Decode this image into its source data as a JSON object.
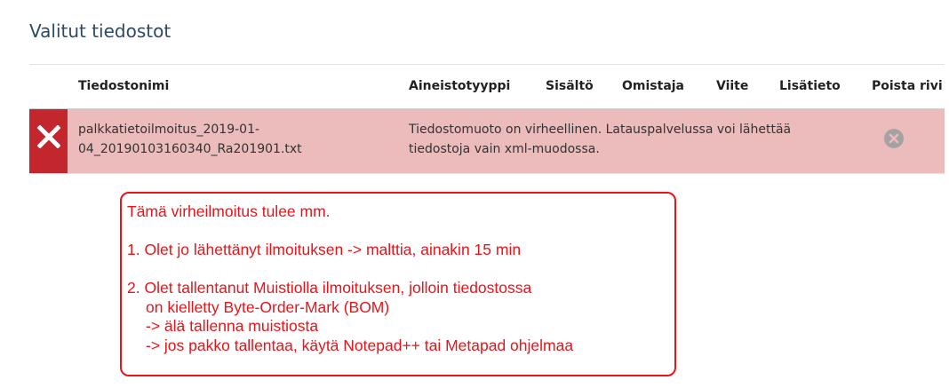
{
  "section": {
    "title": "Valitut tiedostot"
  },
  "table": {
    "headers": {
      "filename": "Tiedostonimi",
      "material_type": "Aineistotyyppi",
      "content": "Sisältö",
      "owner": "Omistaja",
      "reference": "Viite",
      "additional_info": "Lisätieto",
      "remove_row": "Poista rivi"
    },
    "rows": [
      {
        "status": "error",
        "status_icon": "x-icon",
        "filename_line1": "palkkatietoilmoitus_2019-01-",
        "filename_line2": "04_20190103160340_Ra201901.txt",
        "message_line1": "Tiedostomuoto on virheellinen. Latauspalvelussa voi lähettää",
        "message_line2": "tiedostoja vain xml-muodossa.",
        "remove_icon": "remove-circle-icon"
      }
    ]
  },
  "annotation": {
    "line1": "Tämä virheilmoitus tulee mm.",
    "line2": "1. Olet jo lähettänyt ilmoituksen -> malttia, ainakin 15 min",
    "line3": "2. Olet tallentanut Muistiolla ilmoituksen, jolloin tiedostossa",
    "line4": "on kielletty Byte-Order-Mark (BOM)",
    "line5": "-> älä tallenna muistiosta",
    "line6": "-> jos pakko tallentaa, käytä Notepad++ tai Metapad ohjelmaa"
  },
  "colors": {
    "title": "#2d4a67",
    "error_row": "#ecbbbb",
    "error_marker": "#c3262d",
    "annotation": "#e8141a"
  }
}
